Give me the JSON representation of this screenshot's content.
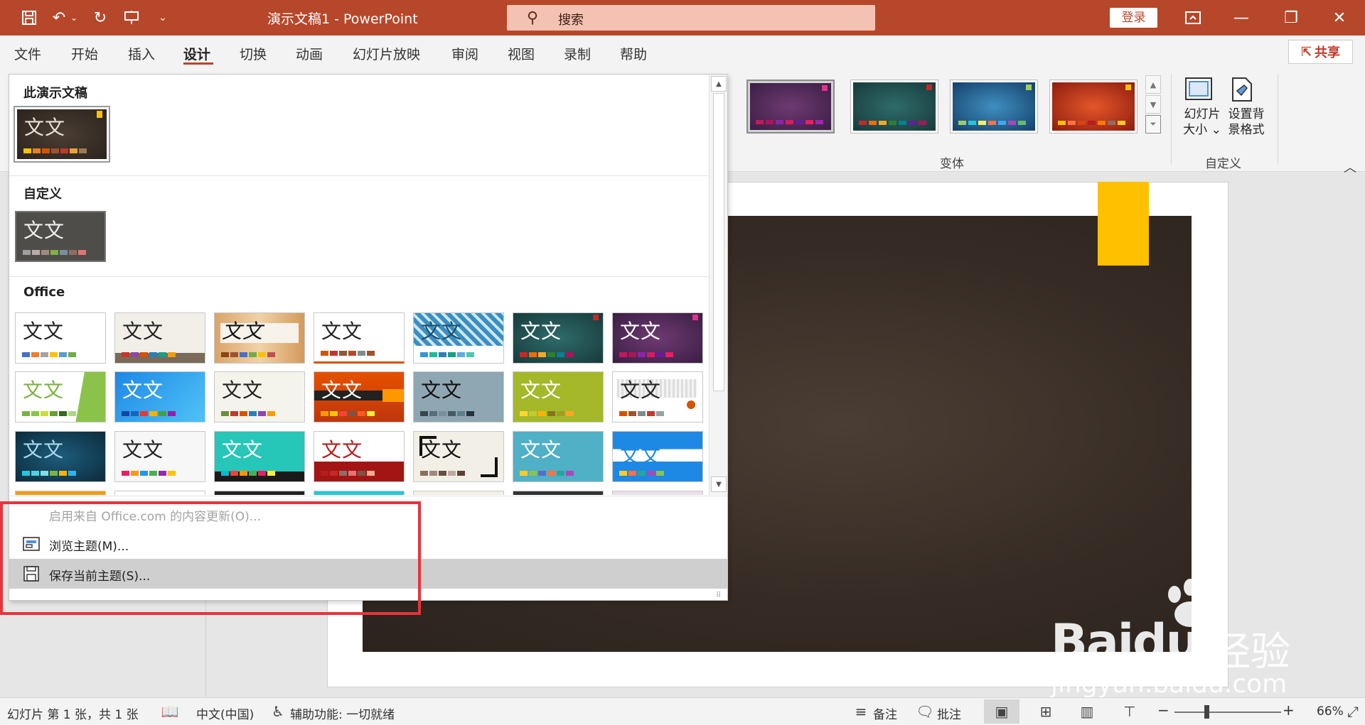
{
  "title_bar": {
    "doc_title": "演示文稿1  -  PowerPoint",
    "search_placeholder": "搜索",
    "login": "登录"
  },
  "menu": {
    "tabs": [
      "文件",
      "开始",
      "插入",
      "设计",
      "切换",
      "动画",
      "幻灯片放映",
      "审阅",
      "视图",
      "录制",
      "帮助"
    ],
    "active_tab": "设计",
    "share": "共享"
  },
  "ribbon": {
    "variants_label": "变体",
    "customize_label": "自定义",
    "slide_size": {
      "line1": "幻灯片",
      "line2": "大小 ⌄"
    },
    "format_bg": {
      "line1": "设置背",
      "line2": "景格式"
    }
  },
  "theme_dropdown": {
    "section_this": "此演示文稿",
    "section_custom": "自定义",
    "section_office": "Office",
    "thumb_text": "文文",
    "menu": {
      "enable_updates": "启用来自 Office.com 的内容更新(O)...",
      "browse": "浏览主题(M)...",
      "save": "保存当前主题(S)..."
    }
  },
  "statusbar": {
    "slide_info": "幻灯片 第 1 张，共 1 张",
    "language": "中文(中国)",
    "accessibility": "辅助功能: 一切就绪",
    "notes": "备注",
    "comments": "批注",
    "zoom": "66%",
    "zoom_level": 0.66
  },
  "watermark": {
    "brand": "Baidu",
    "cn": "经验",
    "url": "jingyan.baidu.com"
  },
  "colors": {
    "accent": "#b7472a",
    "highlight_box": "#e8333c",
    "slide_bg": "#362b24",
    "slide_tab": "#ffc000"
  }
}
